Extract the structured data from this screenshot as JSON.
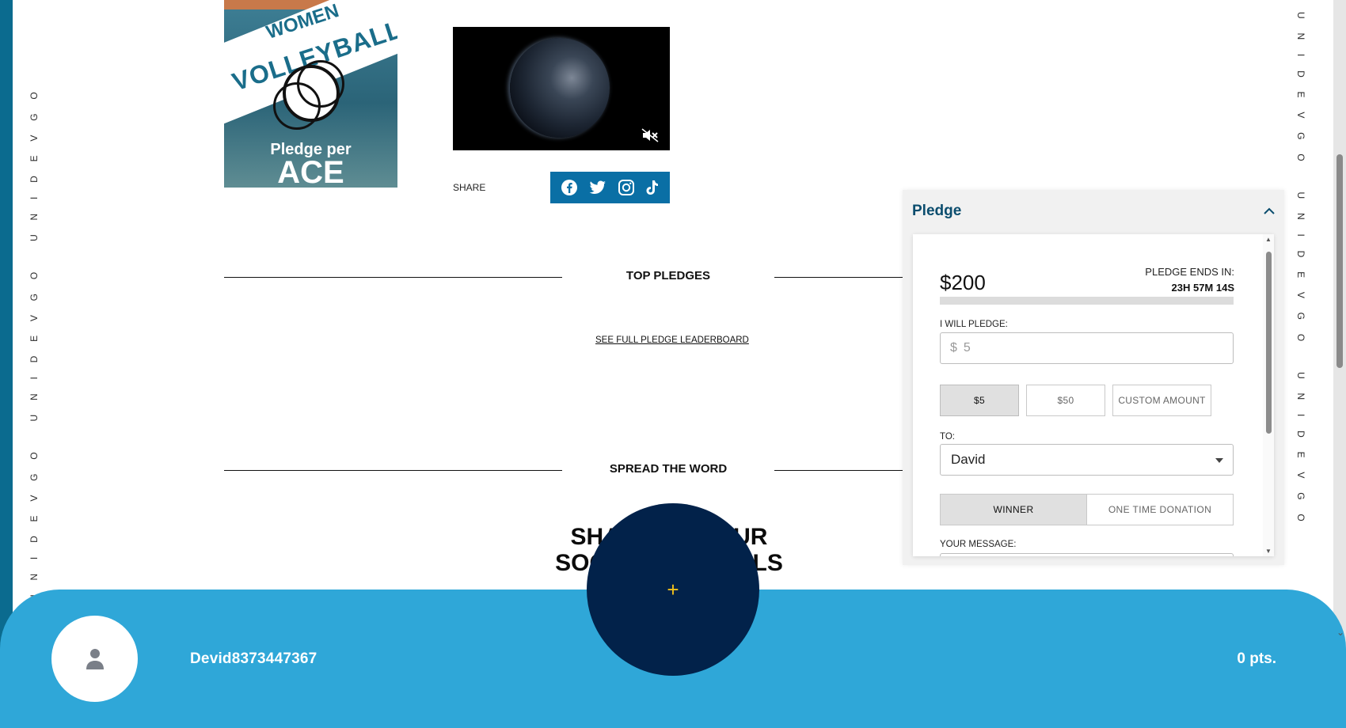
{
  "rail_text": "UNIDEVGO UNIDEVGO UNIDEVGO",
  "poster": {
    "title_line1": "WOMEN",
    "title_line2": "VOLLEYBALL",
    "sub": "Pledge per",
    "ace": "ACE"
  },
  "share": {
    "label": "SHARE",
    "icons": [
      "facebook-icon",
      "twitter-icon",
      "instagram-icon",
      "tiktok-icon"
    ]
  },
  "sections": {
    "top_pledges": "TOP PLEDGES",
    "leaderboard_link": "SEE FULL PLEDGE LEADERBOARD",
    "spread_word": "SPREAD THE WORD",
    "heading_line1": "SHARE TO YOUR",
    "heading_line2": "SOCIAL CHANNELS"
  },
  "pledge": {
    "title": "Pledge",
    "amount": "$200",
    "ends_label": "PLEDGE ENDS IN:",
    "ends_time": "23H 57M 14S",
    "progress": 0.0,
    "will_pledge_label": "I WILL PLEDGE:",
    "currency": "$",
    "input_value": "5",
    "amount_buttons": [
      "$5",
      "$50",
      "CUSTOM AMOUNT"
    ],
    "to_label": "TO:",
    "to_value": "David",
    "type_options": [
      "WINNER",
      "ONE TIME DONATION"
    ],
    "message_label": "YOUR MESSAGE:"
  },
  "user": {
    "username": "Devid8373447367",
    "points": "0 pts."
  },
  "fab": {
    "symbol": "+"
  },
  "colors": {
    "accent": "#0a6fa5",
    "bottom_bar": "#2fa7d8",
    "fab": "#02224a",
    "pledge_title": "#0b4d6e"
  }
}
